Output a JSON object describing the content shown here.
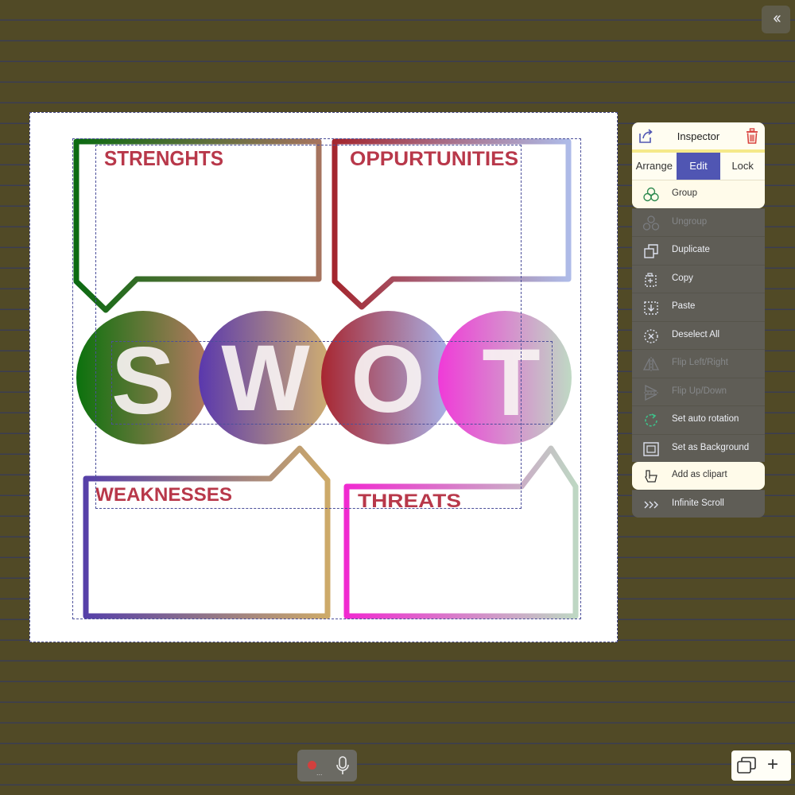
{
  "toolbar": {
    "collapse_label": "‹‹"
  },
  "canvas": {
    "diagram_labels": {
      "strengths": "STRENGHTS",
      "opportunities": "OPPURTUNITIES",
      "weaknesses": "WEAKNESSES",
      "threats": "THREATS"
    },
    "letters": [
      "S",
      "W",
      "O",
      "T"
    ]
  },
  "inspector": {
    "title": "Inspector",
    "tabs": [
      "Arrange",
      "Edit",
      "Lock"
    ],
    "active_tab": "Edit",
    "menu": [
      {
        "label": "Group",
        "icon": "group-icon",
        "enabled": true
      },
      {
        "label": "Ungroup",
        "icon": "ungroup-icon",
        "enabled": false
      },
      {
        "label": "Duplicate",
        "icon": "duplicate-icon",
        "enabled": true
      },
      {
        "label": "Copy",
        "icon": "copy-icon",
        "enabled": true
      },
      {
        "label": "Paste",
        "icon": "paste-icon",
        "enabled": true
      },
      {
        "label": "Deselect All",
        "icon": "deselect-icon",
        "enabled": true
      },
      {
        "label": "Flip Left/Right",
        "icon": "flip-horizontal-icon",
        "enabled": false
      },
      {
        "label": "Flip Up/Down",
        "icon": "flip-vertical-icon",
        "enabled": false
      },
      {
        "label": "Set auto rotation",
        "icon": "rotation-icon",
        "enabled": true
      },
      {
        "label": "Set as Background",
        "icon": "background-icon",
        "enabled": true
      },
      {
        "label": "Add as clipart",
        "icon": "clipart-icon",
        "enabled": true
      },
      {
        "label": "Infinite Scroll",
        "icon": "infinite-scroll-icon",
        "enabled": true
      }
    ]
  },
  "recorder": {
    "ellipsis": "..."
  },
  "colors": {
    "background": "#514a26",
    "accent": "#5056b3",
    "label_red": "#b8384a",
    "delete_red": "#d9433f"
  }
}
